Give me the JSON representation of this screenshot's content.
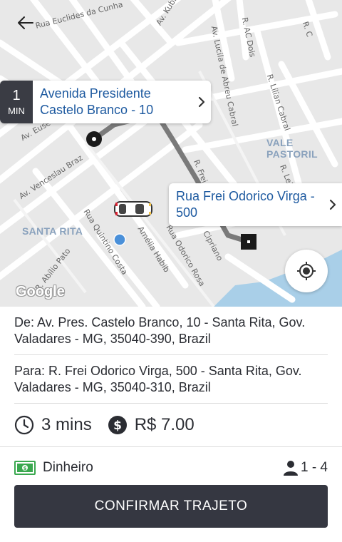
{
  "map": {
    "streets": [
      {
        "label": "Av. Kubitschek"
      },
      {
        "label": "Rua Euclides da Cunha"
      },
      {
        "label": "Av. Lucila de Abreu Cabral"
      },
      {
        "label": "R. AC Dois"
      },
      {
        "label": "R. Lílian Cabral"
      },
      {
        "label": "R. Frei O."
      },
      {
        "label": "R. Leila"
      },
      {
        "label": "Av. Eusê"
      },
      {
        "label": "Av. Venceslau Braz"
      },
      {
        "label": "Rua Quintino Costa"
      },
      {
        "label": "Amélia Habib"
      },
      {
        "label": "Rua Odorico Rosa"
      },
      {
        "label": "Cipriano"
      },
      {
        "label": "R. Abílio Pato"
      },
      {
        "label": "R. C"
      }
    ],
    "areas": {
      "vale_pastoril": "VALE PASTORIL",
      "santa_rita": "SANTA RITA"
    },
    "origin_callout": {
      "eta_value": "1",
      "eta_unit": "MIN",
      "address": "Avenida Presidente Castelo Branco - 10"
    },
    "dest_callout": {
      "address": "Rua Frei Odorico Virga - 500"
    },
    "google_logo": "Google",
    "route_color": "#7a7a7a",
    "icons": [
      "back-arrow-icon",
      "chevron-right-icon",
      "my-location-icon",
      "car-icon",
      "origin-marker-icon",
      "destination-marker-icon",
      "current-location-dot-icon"
    ]
  },
  "trip": {
    "from_text": "De: Av. Pres. Castelo Branco, 10 - Santa Rita, Gov. Valadares - MG, 35040-390, Brazil",
    "to_text": "Para: R. Frei Odorico Virga, 500 - Santa Rita, Gov. Valadares - MG, 35040-310, Brazil",
    "duration": "3 mins",
    "price": "R$ 7.00"
  },
  "payment": {
    "method": "Dinheiro",
    "passengers": "1 - 4",
    "cash_color": "#3aa84f"
  },
  "actions": {
    "confirm_label": "CONFIRMAR TRAJETO"
  },
  "colors": {
    "accent_text": "#1e5aa0",
    "button_bg": "#353741",
    "map_bg": "#e8e8e8",
    "water": "#a9cfe8"
  }
}
